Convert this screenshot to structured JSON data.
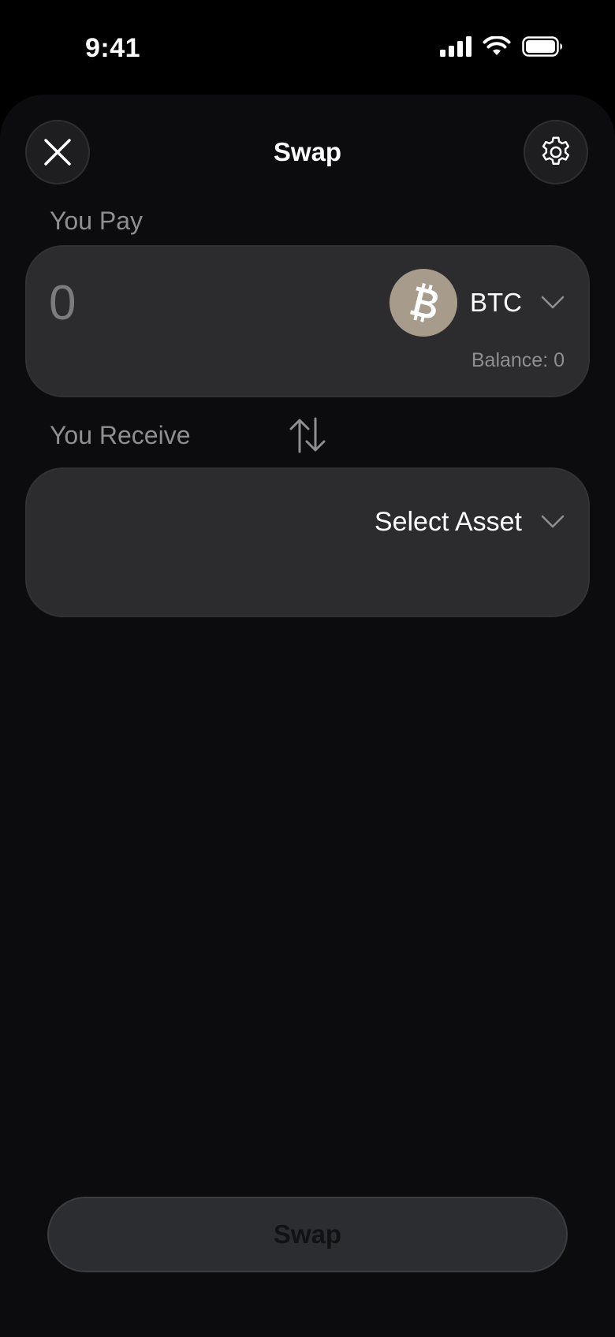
{
  "status_bar": {
    "time": "9:41",
    "icons": [
      "cellular-signal-icon",
      "wifi-icon",
      "battery-icon"
    ]
  },
  "header": {
    "title": "Swap",
    "close_icon": "close-icon",
    "settings_icon": "gear-icon"
  },
  "pay": {
    "label": "You Pay",
    "amount": "0",
    "asset_symbol": "BTC",
    "asset_icon": "bitcoin-icon",
    "balance": "Balance: 0"
  },
  "receive": {
    "label": "You Receive",
    "select_label": "Select Asset"
  },
  "swap_direction_icon": "swap-vertical-arrows-icon",
  "footer": {
    "swap_label": "Swap"
  },
  "colors": {
    "background": "#0c0c0e",
    "card": "#2c2c2e",
    "muted_text": "#8e8e93",
    "bitcoin_badge": "#a79c8c",
    "swap_button": "#2b2d31"
  }
}
